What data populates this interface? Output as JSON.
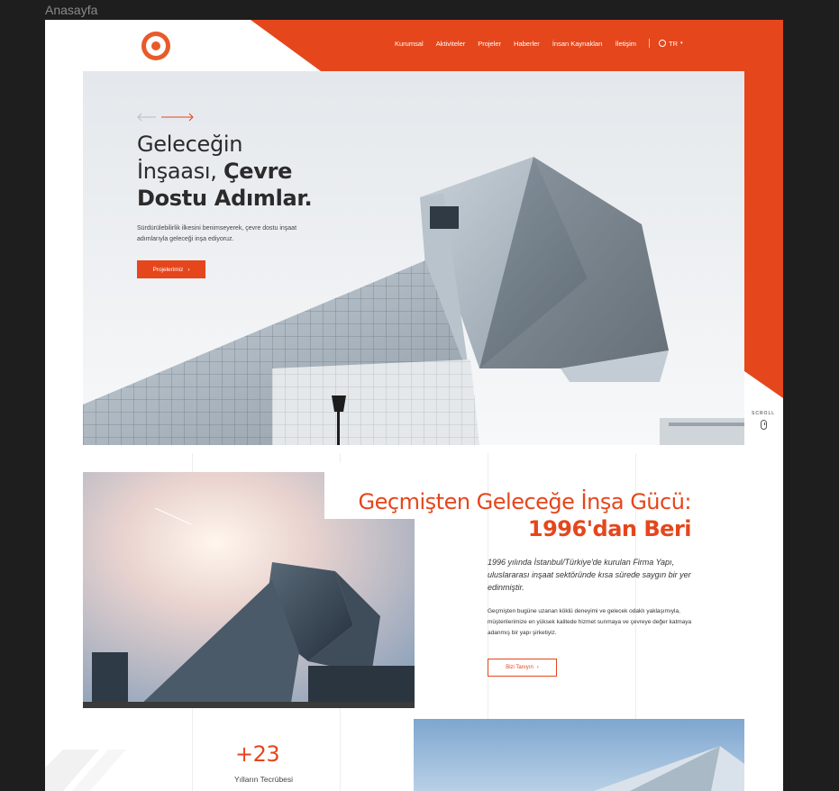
{
  "frame": {
    "title": "Anasayfa"
  },
  "colors": {
    "accent": "#e5461c",
    "nav_text": "#ffffff",
    "text_dark": "#2b2b2b"
  },
  "nav": {
    "items": [
      "Kurumsal",
      "Aktiviteler",
      "Projeler",
      "Haberler",
      "İnsan Kaynakları",
      "İletişim"
    ],
    "lang": "TR",
    "lang_icon": "globe-icon"
  },
  "hero": {
    "title_line1": "Geleceğin",
    "title_line2_a": "İnşaası, ",
    "title_line2_b": "Çevre",
    "title_line3": "Dostu Adımlar.",
    "subtitle": "Sürdürülebilirlik ilkesini benimseyerek, çevre dostu inşaat adımlarıyla geleceği inşa ediyoruz.",
    "button_label": "Projelerimiz",
    "scroll_label": "SCROLL"
  },
  "about": {
    "title_line1": "Geçmişten Geleceğe İnşa Gücü:",
    "title_line2": "1996'dan Beri",
    "paragraph1": "1996 yılında İstanbul/Türkiye'de kurulan Firma Yapı, uluslararası inşaat sektöründe kısa sürede saygın bir yer edinmiştir.",
    "paragraph2": "Geçmişten bugüne uzanan köklü deneyimi ve gelecek odaklı yaklaşımıyla, müşterilerimize en yüksek kalitede hizmet sunmaya ve çevreye değer katmaya adanmış bir yapı şirketiyiz.",
    "button_label": "Bizi Tanıyın"
  },
  "stats": {
    "value": "+23",
    "label": "Yılların Tecrübesi"
  }
}
